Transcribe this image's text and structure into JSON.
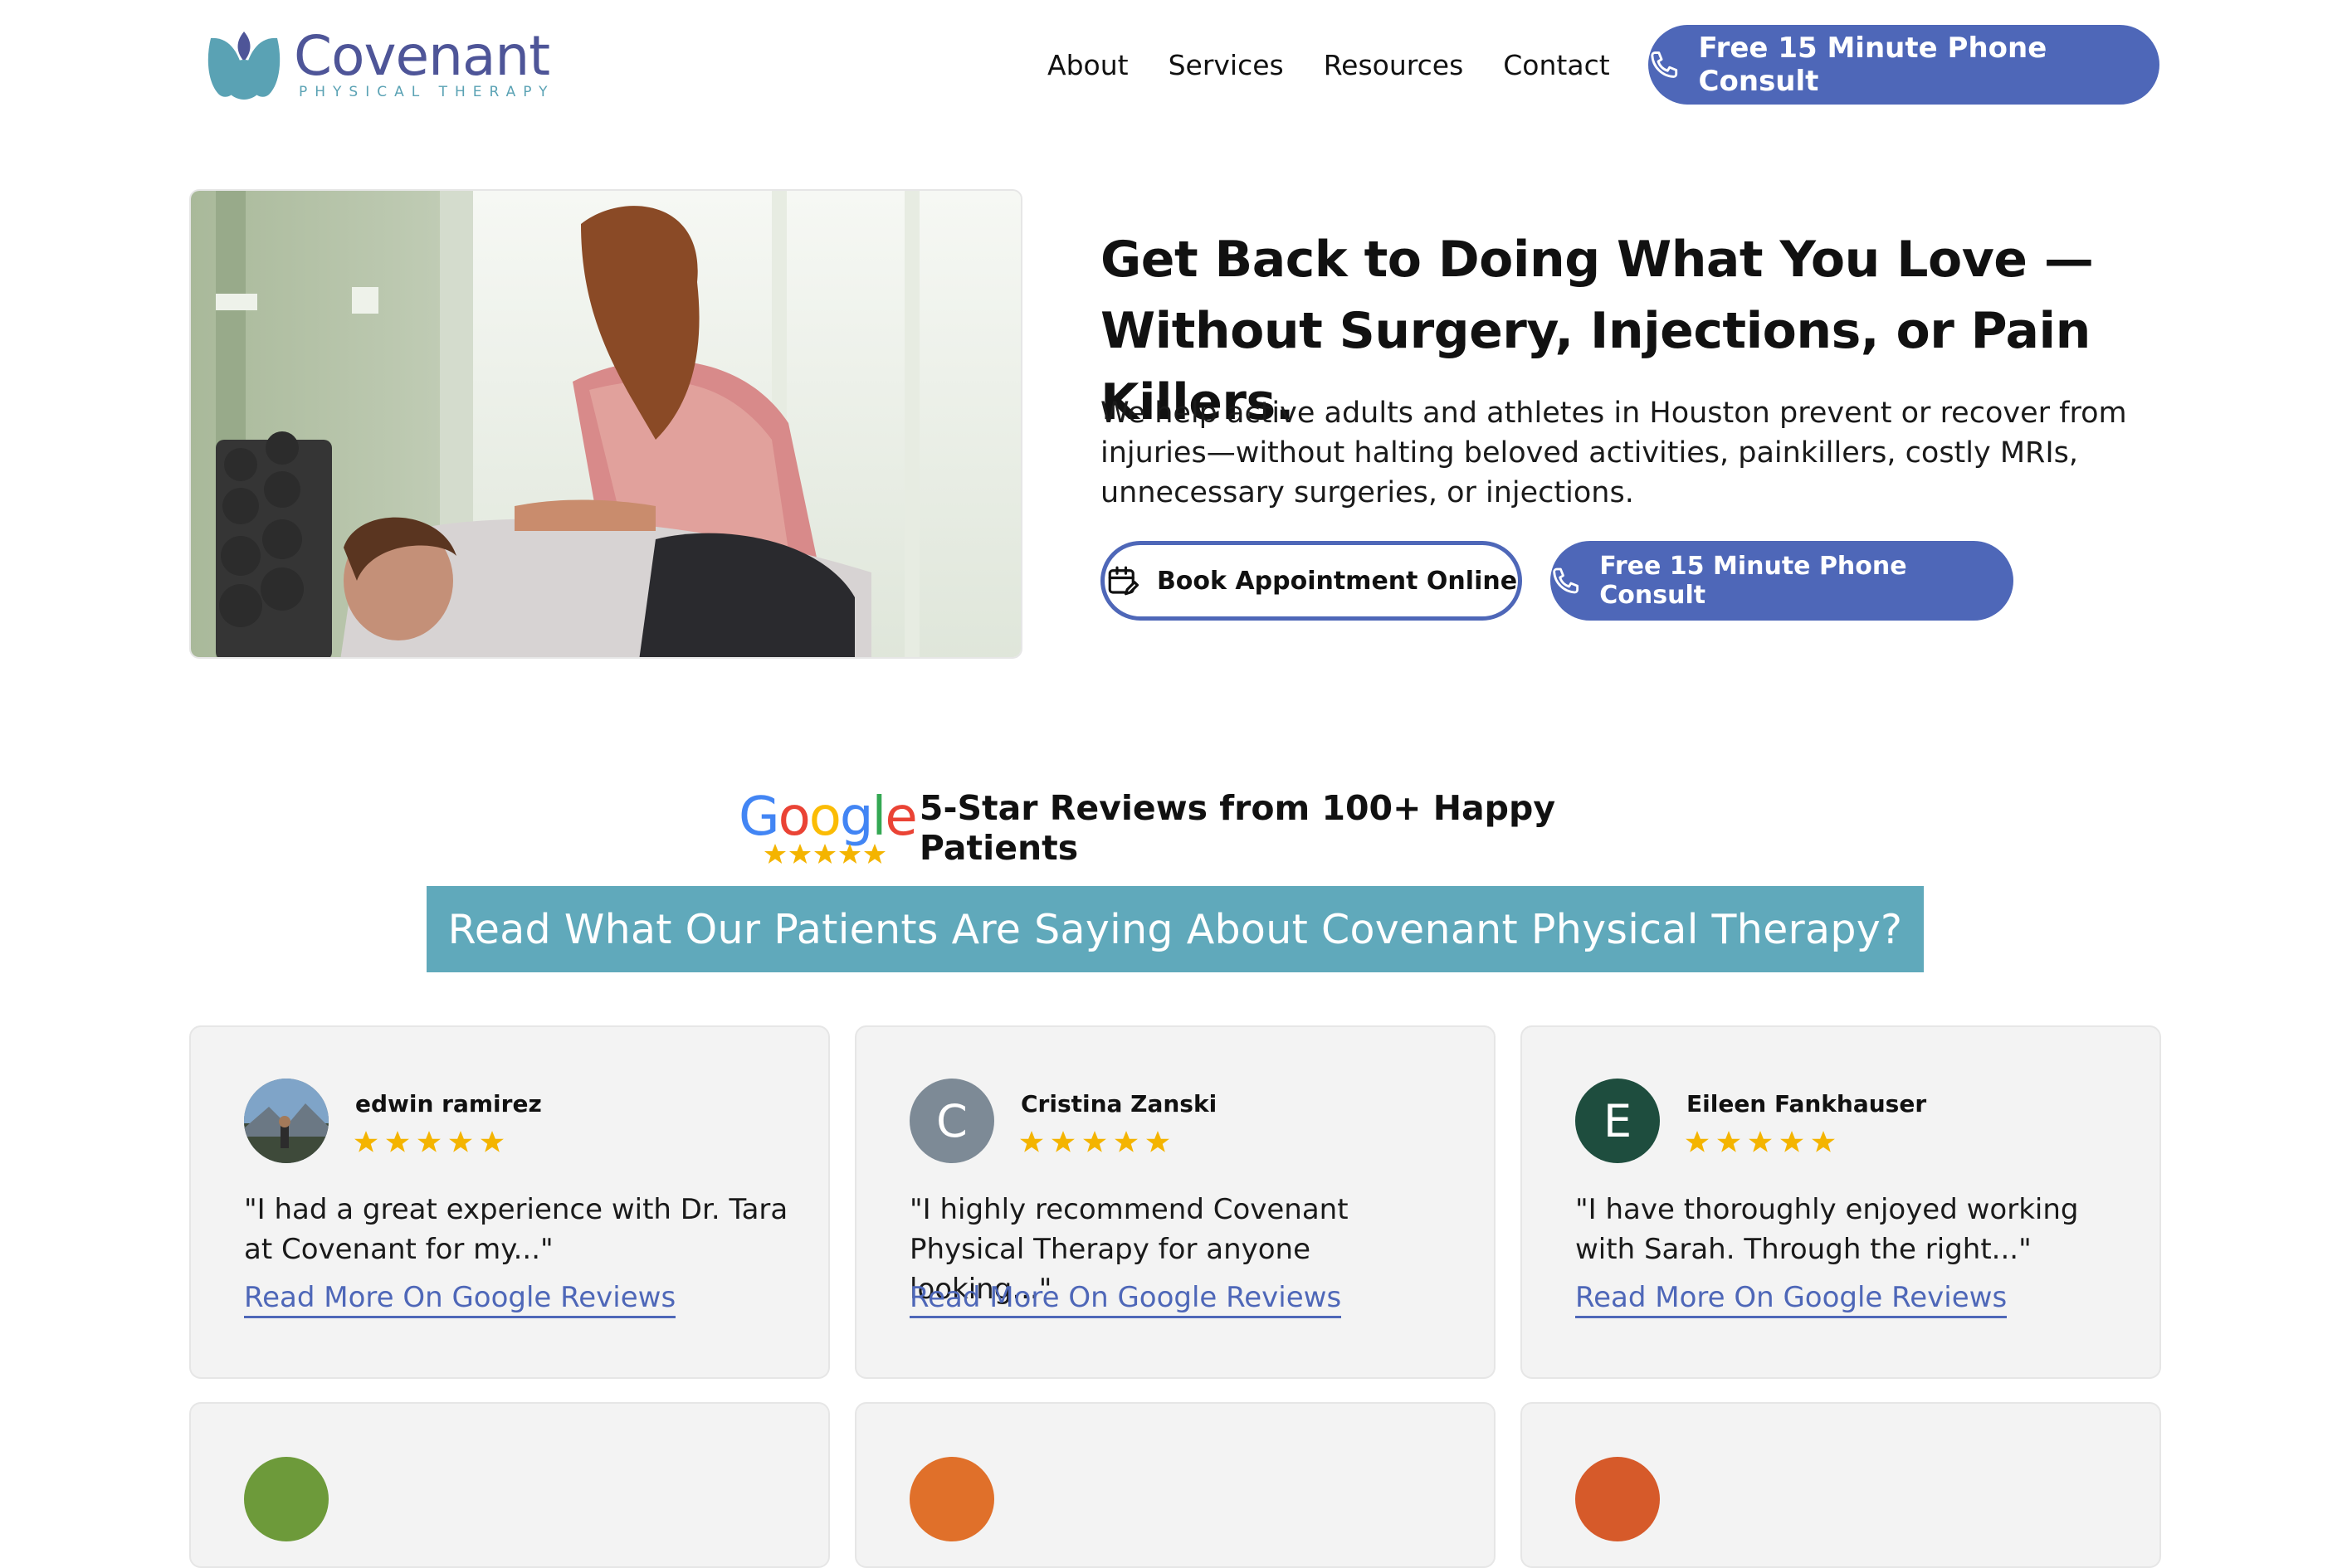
{
  "brand": {
    "name": "Covenant",
    "tagline": "PHYSICAL THERAPY",
    "primary_color": "#4e67b8",
    "accent_color": "#60a9bb",
    "logo_icon": "lotus-leaf-logo"
  },
  "nav": {
    "items": [
      {
        "label": "About"
      },
      {
        "label": "Services"
      },
      {
        "label": "Resources"
      },
      {
        "label": "Contact"
      }
    ],
    "cta_label": "Free 15 Minute Phone Consult",
    "cta_icon": "phone-icon"
  },
  "hero": {
    "title": "Get Back to Doing What You Love — Without Surgery, Injections, or Pain Killers.",
    "description": "We help active adults and athletes in Houston prevent or recover from injuries—without halting beloved activities, painkillers, costly MRIs, unnecessary surgeries, or injections.",
    "book_label": "Book Appointment Online",
    "book_icon": "calendar-edit-icon",
    "consult_label": "Free 15 Minute Phone Consult",
    "consult_icon": "phone-icon",
    "image_subject": "therapist-treating-patient-photo"
  },
  "reviews": {
    "google_word": "Google",
    "headline": "5-Star Reviews from 100+ Happy Patients",
    "banner": "Read What Our Patients Are Saying About Covenant Physical Therapy?",
    "star_color": "#f4b400",
    "items": [
      {
        "name": "edwin ramirez",
        "initial": "",
        "avatar_color": "#5a6a7a",
        "rating": 5,
        "text": "\"I had a great experience with Dr. Tara at Covenant for my...\"",
        "link": "Read More On Google Reviews"
      },
      {
        "name": "Cristina Zanski",
        "initial": "C",
        "avatar_color": "#7d8a96",
        "rating": 5,
        "text": "\"I highly recommend Covenant Physical Therapy for anyone looking...\"",
        "link": "Read More On Google Reviews"
      },
      {
        "name": "Eileen Fankhauser",
        "initial": "E",
        "avatar_color": "#1e4d3e",
        "rating": 5,
        "text": "\"I have thoroughly enjoyed working with Sarah. Through the right...\"",
        "link": "Read More On Google Reviews"
      }
    ],
    "partial_row_avatar_colors": [
      "#6d9a3a",
      "#e0702a",
      "#d65a2a"
    ]
  }
}
